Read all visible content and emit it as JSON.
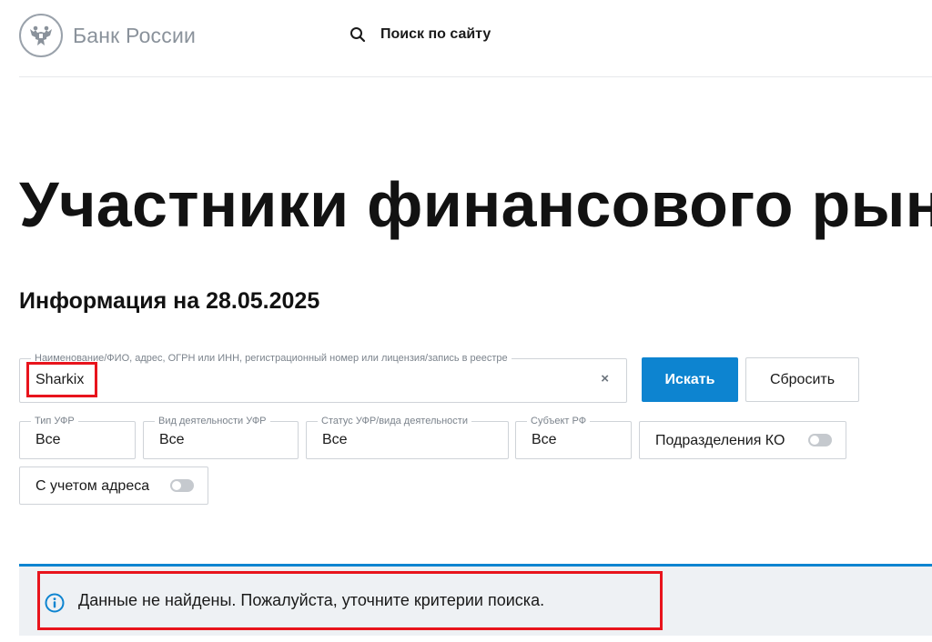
{
  "header": {
    "logo_text": "Банк России",
    "search_label": "Поиск по сайту"
  },
  "page": {
    "title": "Участники финансового рын",
    "info_date": "Информация на 28.05.2025"
  },
  "form": {
    "query": {
      "label": "Наименование/ФИО, адрес, ОГРН или ИНН, регистрационный номер или лицензия/запись в реестре",
      "value": "Sharkix",
      "clear_symbol": "×"
    },
    "search_button": "Искать",
    "reset_button": "Сбросить",
    "filters": {
      "ufr_type": {
        "label": "Тип УФР",
        "value": "Все"
      },
      "activity_type": {
        "label": "Вид деятельности УФР",
        "value": "Все"
      },
      "status": {
        "label": "Статус УФР/вида деятельности",
        "value": "Все"
      },
      "region": {
        "label": "Субъект РФ",
        "value": "Все"
      }
    },
    "toggles": {
      "ko_divisions": {
        "label": "Подразделения КО",
        "checked": false
      },
      "with_address": {
        "label": "С учетом адреса",
        "checked": false
      }
    }
  },
  "result": {
    "message": "Данные не найдены. Пожалуйста, уточните критерии поиска."
  },
  "colors": {
    "accent": "#0d84d0",
    "highlight": "#e8141c",
    "result_background": "#eef1f4"
  },
  "icons": {
    "logo": "double-headed-eagle-icon",
    "search": "search-icon",
    "clear": "close-icon",
    "info": "info-icon"
  }
}
